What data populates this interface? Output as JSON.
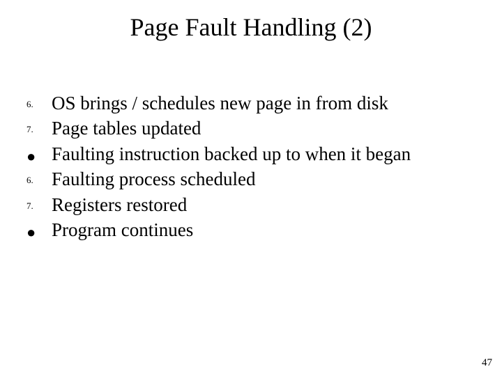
{
  "title": "Page Fault Handling (2)",
  "items": [
    {
      "marker": "6.",
      "marker_kind": "num",
      "text": "OS brings / schedules new page in from disk"
    },
    {
      "marker": "7.",
      "marker_kind": "num",
      "text": "Page tables updated"
    },
    {
      "marker": "●",
      "marker_kind": "dot",
      "text": "Faulting instruction backed up to when it began"
    },
    {
      "marker": "6.",
      "marker_kind": "num",
      "text": "Faulting process scheduled"
    },
    {
      "marker": "7.",
      "marker_kind": "num",
      "text": "Registers restored"
    },
    {
      "marker": "●",
      "marker_kind": "dot",
      "text": "Program continues"
    }
  ],
  "page_number": "47"
}
